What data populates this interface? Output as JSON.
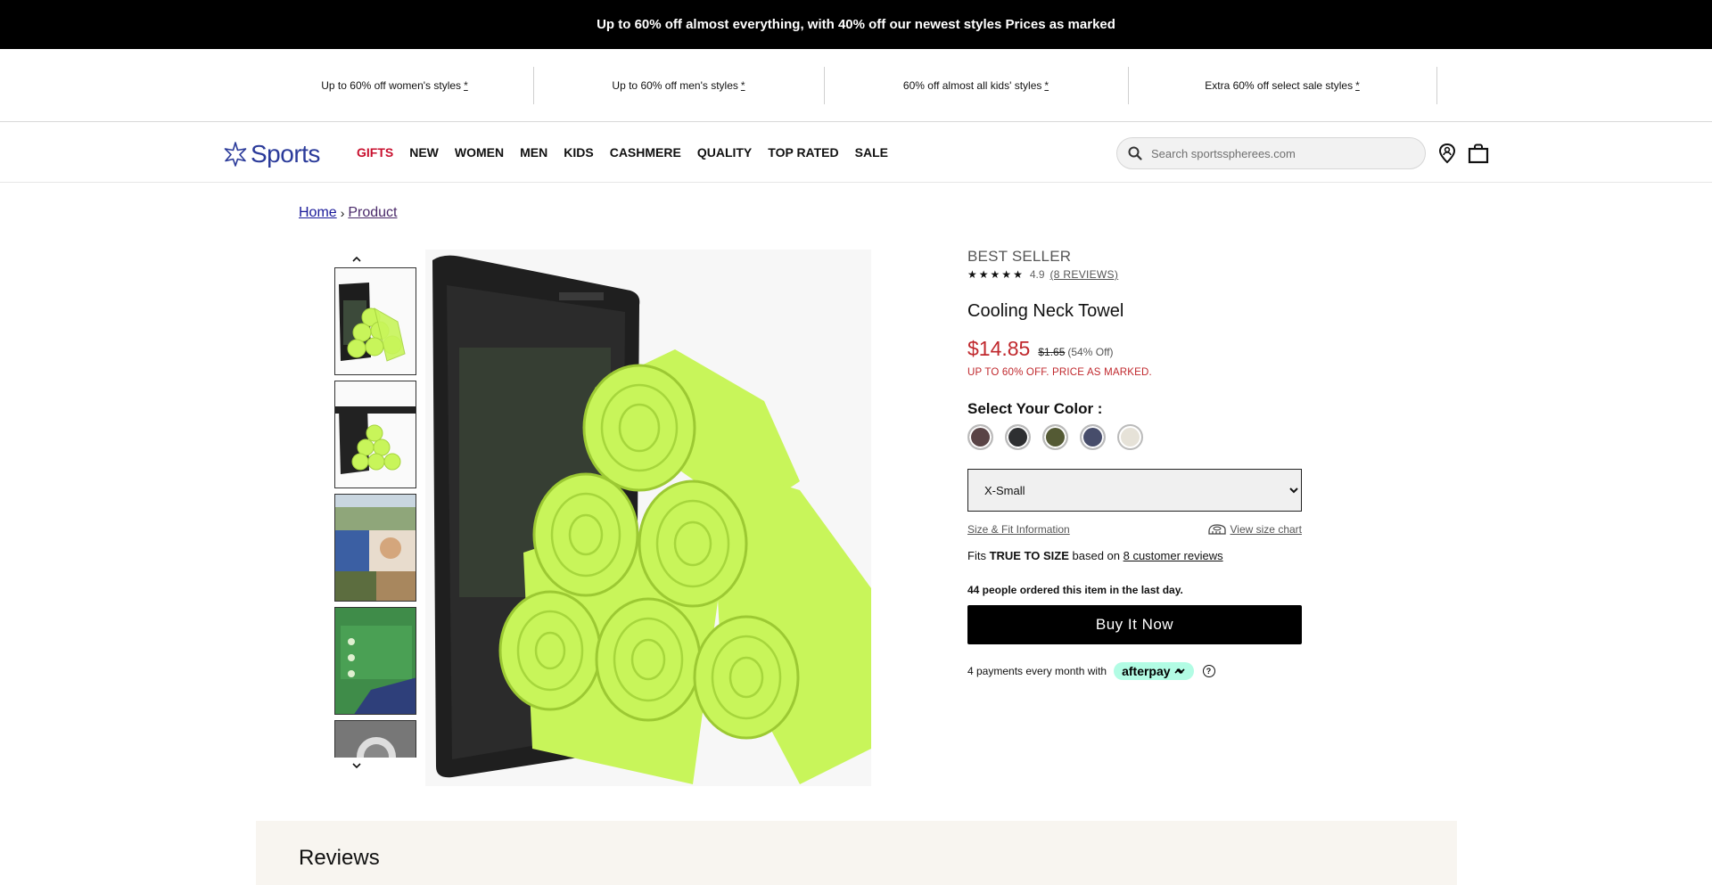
{
  "top_banner": {
    "text": "Up to 60% off almost everything, with 40% off our newest styles Prices as marked"
  },
  "promo_strip": [
    {
      "text": "Up to 60% off women's styles",
      "mark": "*"
    },
    {
      "text": "Up to 60% off men's styles",
      "mark": "*"
    },
    {
      "text": "60% off almost all kids' styles",
      "mark": "*"
    },
    {
      "text": "Extra 60% off select sale styles",
      "mark": "*"
    }
  ],
  "header": {
    "logo_text": "Sports",
    "nav": [
      "GIFTS",
      "NEW",
      "WOMEN",
      "MEN",
      "KIDS",
      "CASHMERE",
      "QUALITY",
      "TOP RATED",
      "SALE"
    ],
    "search_placeholder": "Search sportsspherees.com",
    "icons": [
      "search-icon",
      "store-locator-icon",
      "shopping-bag-icon"
    ]
  },
  "breadcrumb": {
    "home": "Home",
    "separator": "›",
    "current": "Product"
  },
  "product": {
    "badge": "BEST SELLER",
    "stars": [
      "★",
      "★",
      "★",
      "★",
      "★"
    ],
    "rating": "4.9",
    "reviews_link": "(8 REVIEWS)",
    "title": "Cooling Neck Towel",
    "price": "$14.85",
    "old_price": "$1.65",
    "discount": "(54% Off)",
    "promo_note": "UP TO 60% OFF. PRICE AS MARKED.",
    "color_label": "Select Your Color :",
    "colors": [
      "#5a4446",
      "#2e2f31",
      "#545a34",
      "#474d6b",
      "#e6e2d8"
    ],
    "size_selected": "X-Small",
    "size_fit_link": "Size & Fit Information",
    "size_chart_link": "View size chart",
    "fits_prefix": "Fits ",
    "fits_value": "TRUE TO SIZE",
    "fits_middle": " based on ",
    "fits_link": "8 customer reviews",
    "ordered_note": "44 people ordered this item in the last day.",
    "buy_label": "Buy It Now",
    "afterpay_text": "4 payments every month with",
    "afterpay_brand": "afterpay",
    "help_glyph": "?"
  },
  "reviews": {
    "heading": "Reviews"
  },
  "colors": {
    "sale_red": "#c0282d",
    "brand_blue": "#2b3b9a",
    "towel_green": "#c8f55a"
  }
}
